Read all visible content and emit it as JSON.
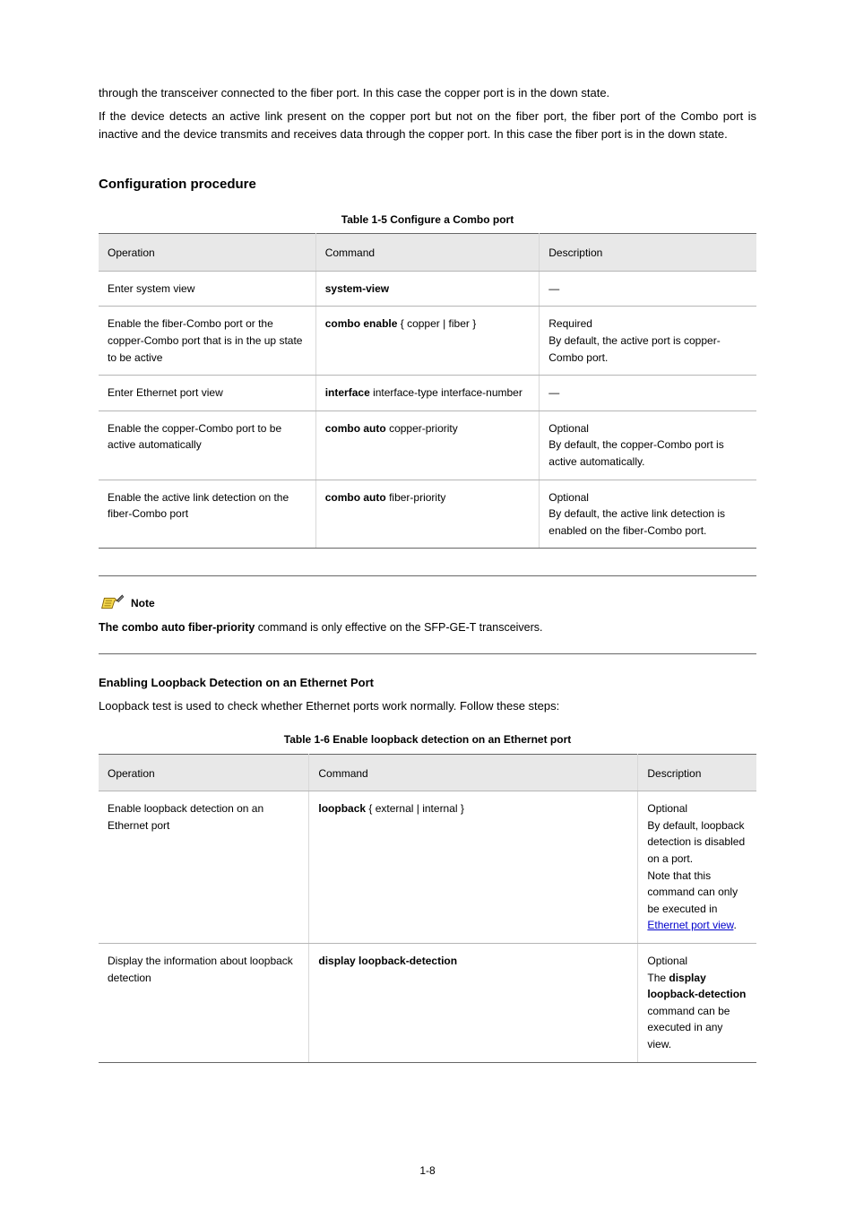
{
  "intro": {
    "p1": "through the transceiver connected to the fiber port. In this case the copper port is in the down state.",
    "p2": "If the device detects an active link present on the copper port but not on the fiber port, the fiber port of the Combo port is inactive and the device transmits and receives data through the copper port. In this case the fiber port is in the down state."
  },
  "config_proc": {
    "heading": "Configuration procedure",
    "caption": "Table 1-5 Configure a Combo port",
    "headers": [
      "Operation",
      "Command",
      "Description"
    ],
    "rows": [
      {
        "op": "Enter system view",
        "cmd_bold": "system-view",
        "cmd_rest": "",
        "desc": "—"
      },
      {
        "op": "Enable the fiber-Combo port or the copper-Combo port that is in the up state to be active",
        "cmd_bold": "combo enable",
        "cmd_rest": " { copper | fiber }",
        "desc": "Required\nBy default, the active port is copper-Combo port."
      },
      {
        "op": "Enter Ethernet port view",
        "cmd_bold": "interface",
        "cmd_rest": " interface-type interface-number",
        "desc": "—"
      },
      {
        "op": "Enable the copper-Combo port to be active automatically",
        "cmd_bold": "combo auto ",
        "cmd_rest": "copper-priority",
        "desc": "Optional\nBy default, the copper-Combo port is active automatically."
      },
      {
        "op": "Enable the active link detection on the fiber-Combo port",
        "cmd_bold": "combo auto ",
        "cmd_rest": "fiber-priority",
        "desc": "Optional\nBy default, the active link detection is enabled on the fiber-Combo port."
      }
    ]
  },
  "note": {
    "label": "Note",
    "text_prefix_bold": "The combo auto fiber-priority",
    "text_rest": " command is only effective on the SFP-GE-T transceivers."
  },
  "loopback": {
    "heading": "Enabling Loopback Detection on an Ethernet Port",
    "intro": "Loopback test is used to check whether Ethernet ports work normally. Follow these steps:",
    "caption": "Table 1-6 Enable loopback detection on an Ethernet port",
    "headers": [
      "Operation",
      "Command",
      "Description"
    ],
    "rows": [
      {
        "op": "Enable loopback detection on an Ethernet port",
        "cmd_bold": "loopback",
        "cmd_rest": " { external | internal }",
        "desc_pre": "Optional\nBy default, loopback detection is disabled on a port.\nNote that this command can only be executed in ",
        "desc_link": "Ethernet port view",
        "desc_post": "."
      },
      {
        "op": "Display the information about loopback detection",
        "cmd_bold": "display loopback-detection",
        "cmd_rest": "",
        "desc_pre": "Optional\nThe ",
        "desc_bold": "display loopback-detection",
        "desc_post2": " command can be executed in any view."
      }
    ]
  },
  "page_number": "1-8"
}
